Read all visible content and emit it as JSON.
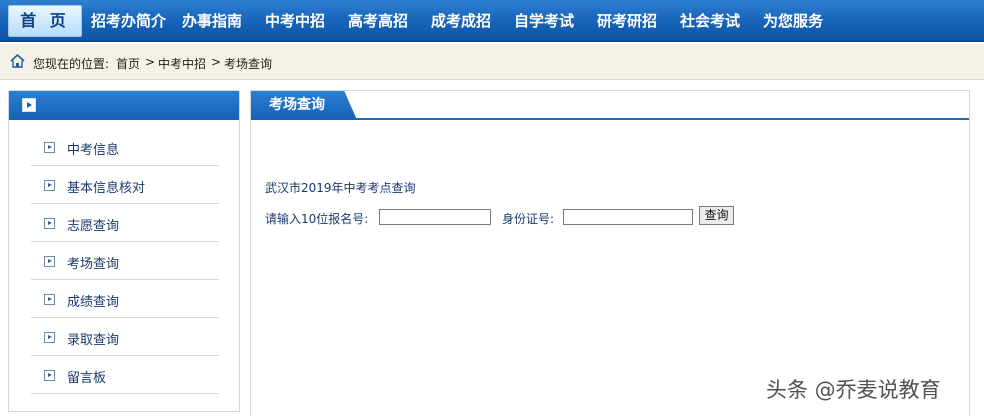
{
  "nav": {
    "home": "首 页",
    "items": [
      "招考办简介",
      "办事指南",
      "中考中招",
      "高考高招",
      "成考成招",
      "自学考试",
      "研考研招",
      "社会考试",
      "为您服务"
    ]
  },
  "breadcrumb": {
    "prefix": "您现在的位置:",
    "items": [
      "首页",
      "中考中招",
      "考场查询"
    ],
    "separator": ">"
  },
  "sidebar": {
    "items": [
      "中考信息",
      "基本信息核对",
      "志愿查询",
      "考场查询",
      "成绩查询",
      "录取查询",
      "留言板"
    ]
  },
  "panel": {
    "tab": "考场查询",
    "subtitle": "武汉市2019年中考考点查询",
    "form": {
      "reg_label": "请输入10位报名号:",
      "reg_value": "",
      "id_label": "身份证号:",
      "id_value": "",
      "submit": "查询"
    }
  },
  "watermark": "头条 @乔麦说教育",
  "colors": {
    "nav_blue": "#1663b8",
    "crumb_bg": "#f4f1e8",
    "text": "#1a3a6b"
  }
}
